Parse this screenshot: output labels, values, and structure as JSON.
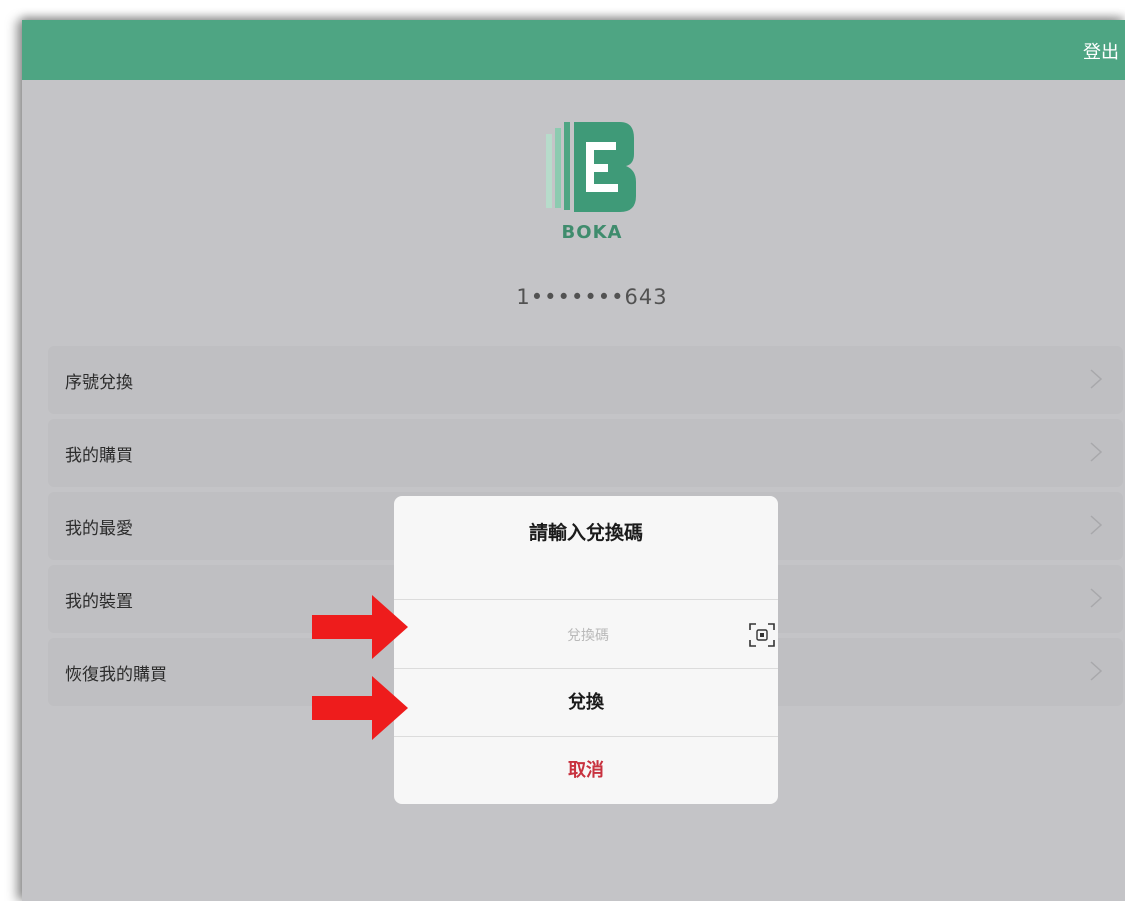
{
  "topbar": {
    "logout_label": "登出",
    "color": "#4ea583"
  },
  "brand": {
    "name": "BOKA",
    "color": "#3f8c6d"
  },
  "account": {
    "id_text": "1•••••••643"
  },
  "menu": {
    "items": [
      {
        "label": "序號兌換"
      },
      {
        "label": "我的購買"
      },
      {
        "label": "我的最愛"
      },
      {
        "label": "我的裝置"
      },
      {
        "label": "恢復我的購買"
      }
    ]
  },
  "dialog": {
    "title": "請輸入兌換碼",
    "input_placeholder": "兌換碼",
    "input_value": "",
    "redeem_label": "兌換",
    "cancel_label": "取消",
    "cancel_color": "#c8323f"
  },
  "annotations": {
    "arrow_color": "#ee1c1c"
  }
}
